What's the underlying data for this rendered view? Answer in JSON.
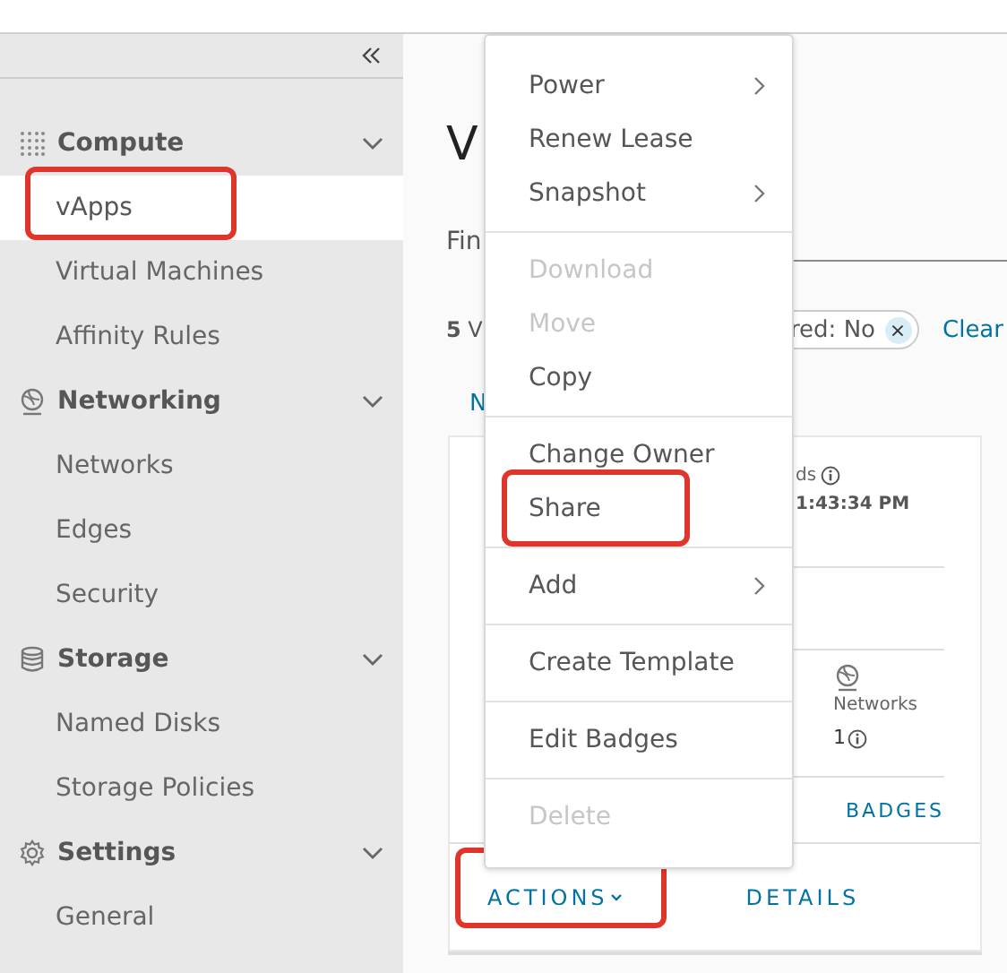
{
  "sidebar": {
    "groups": [
      {
        "label": "Compute",
        "expanded": true,
        "items": [
          {
            "label": "vApps",
            "selected": true,
            "highlighted": true
          },
          {
            "label": "Virtual Machines",
            "selected": false,
            "highlighted": false
          },
          {
            "label": "Affinity Rules",
            "selected": false,
            "highlighted": false
          }
        ]
      },
      {
        "label": "Networking",
        "expanded": true,
        "items": [
          {
            "label": "Networks",
            "selected": false,
            "highlighted": false
          },
          {
            "label": "Edges",
            "selected": false,
            "highlighted": false
          },
          {
            "label": "Security",
            "selected": false,
            "highlighted": false
          }
        ]
      },
      {
        "label": "Storage",
        "expanded": true,
        "items": [
          {
            "label": "Named Disks",
            "selected": false,
            "highlighted": false
          },
          {
            "label": "Storage Policies",
            "selected": false,
            "highlighted": false
          }
        ]
      },
      {
        "label": "Settings",
        "expanded": true,
        "items": [
          {
            "label": "General",
            "selected": false,
            "highlighted": false
          }
        ]
      }
    ]
  },
  "main": {
    "title": "V",
    "find_label": "Fin",
    "count": "**5** V",
    "filter_chip": {
      "label": "red: No",
      "remove": "×"
    },
    "clear_link": "Clear",
    "tab": "N",
    "card": {
      "field_label": "ds",
      "time": "1:43:34 PM",
      "networks_label": "Networks",
      "networks_count": "1",
      "badges_link": "BADGES",
      "actions": {
        "label": "ACTIONS",
        "highlighted": true
      },
      "details": "DETAILS"
    }
  },
  "menu": {
    "groups": [
      [
        {
          "label": "Power",
          "disabled": false,
          "submenu": true,
          "highlighted": false
        },
        {
          "label": "Renew Lease",
          "disabled": false,
          "submenu": false,
          "highlighted": false
        },
        {
          "label": "Snapshot",
          "disabled": false,
          "submenu": true,
          "highlighted": false
        }
      ],
      [
        {
          "label": "Download",
          "disabled": true,
          "submenu": false,
          "highlighted": false
        },
        {
          "label": "Move",
          "disabled": true,
          "submenu": false,
          "highlighted": false
        },
        {
          "label": "Copy",
          "disabled": false,
          "submenu": false,
          "highlighted": false
        }
      ],
      [
        {
          "label": "Change Owner",
          "disabled": false,
          "submenu": false,
          "highlighted": false
        },
        {
          "label": "Share",
          "disabled": false,
          "submenu": false,
          "highlighted": true
        }
      ],
      [
        {
          "label": "Add",
          "disabled": false,
          "submenu": true,
          "highlighted": false
        }
      ],
      [
        {
          "label": "Create Template",
          "disabled": false,
          "submenu": false,
          "highlighted": false
        }
      ],
      [
        {
          "label": "Edit Badges",
          "disabled": false,
          "submenu": false,
          "highlighted": false
        }
      ],
      [
        {
          "label": "Delete",
          "disabled": true,
          "submenu": false,
          "highlighted": false
        }
      ]
    ]
  }
}
